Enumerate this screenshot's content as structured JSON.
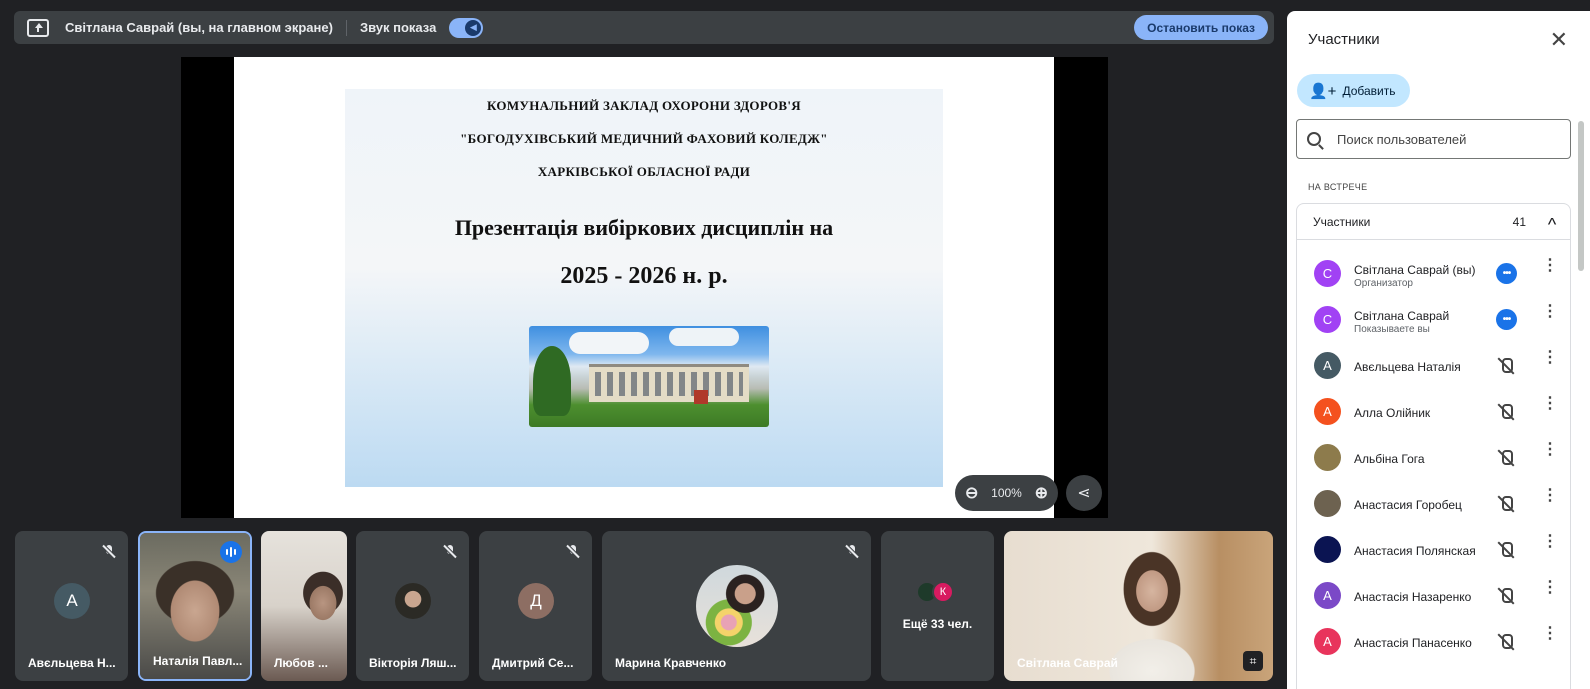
{
  "topbar": {
    "presenter_label": "Світлана Саврай (вы, на главном экране)",
    "sound_label": "Звук показа",
    "sound_on": true,
    "stop_label": "Остановить показ"
  },
  "slide": {
    "institution_line1": "КОМУНАЛЬНИЙ ЗАКЛАД ОХОРОНИ ЗДОРОВ'Я",
    "institution_line2": "\"БОГОДУХІВСЬКИЙ МЕДИЧНИЙ ФАХОВИЙ КОЛЕДЖ\"",
    "institution_line3": "ХАРКІВСЬКОЇ ОБЛАСНОЇ РАДИ",
    "title": "Презентація вибіркових дисциплін на",
    "years": "2025 - 2026 н. р.",
    "zoom_level": "100%"
  },
  "tiles": [
    {
      "name": "Авєльцева Н...",
      "initial": "А",
      "muted": true
    },
    {
      "name": "Наталія Павл...",
      "speaking": true
    },
    {
      "name": "Любов ..."
    },
    {
      "name": "Вікторія Ляш...",
      "muted": true
    },
    {
      "name": "Дмитрий Се...",
      "initial": "Д",
      "muted": true
    },
    {
      "name": "Марина Кравченко",
      "muted": true
    },
    {
      "name": "Ещё 33 чел.",
      "initial": "К"
    },
    {
      "name": "Світлана Саврай"
    }
  ],
  "panel": {
    "title": "Участники",
    "add_label": "Добавить",
    "search_placeholder": "Поиск пользователей",
    "section_label": "НА ВСТРЕЧЕ",
    "group_label": "Участники",
    "group_count": "41",
    "participants": [
      {
        "initial": "С",
        "name": "Світлана Саврай (вы)",
        "sub": "Организатор",
        "color": "#a142f4",
        "status": "more"
      },
      {
        "initial": "С",
        "name": "Світлана Саврай",
        "sub": "Показываете вы",
        "color": "#a142f4",
        "status": "more"
      },
      {
        "initial": "А",
        "name": "Авєльцева Наталія",
        "sub": "",
        "color": "#455a64",
        "status": "muted"
      },
      {
        "initial": "А",
        "name": "Алла Олійник",
        "sub": "",
        "color": "#f4511e",
        "status": "muted"
      },
      {
        "initial": "",
        "name": "Альбіна Гога",
        "sub": "",
        "color": "#8d7b4c",
        "status": "muted"
      },
      {
        "initial": "",
        "name": "Анастасия Горобец",
        "sub": "",
        "color": "#6d6250",
        "status": "muted"
      },
      {
        "initial": "",
        "name": "Анастасия Полянская",
        "sub": "",
        "color": "#0b1452",
        "status": "muted"
      },
      {
        "initial": "А",
        "name": "Анастасія Назаренко",
        "sub": "",
        "color": "#7b49c7",
        "status": "muted"
      },
      {
        "initial": "А",
        "name": "Анастасія Панасенко",
        "sub": "",
        "color": "#e8345c",
        "status": "muted"
      }
    ]
  },
  "colors": {
    "background": "#202124",
    "tile": "#3c4043",
    "accent": "#8ab4f8",
    "speaking": "#1a73e8"
  }
}
